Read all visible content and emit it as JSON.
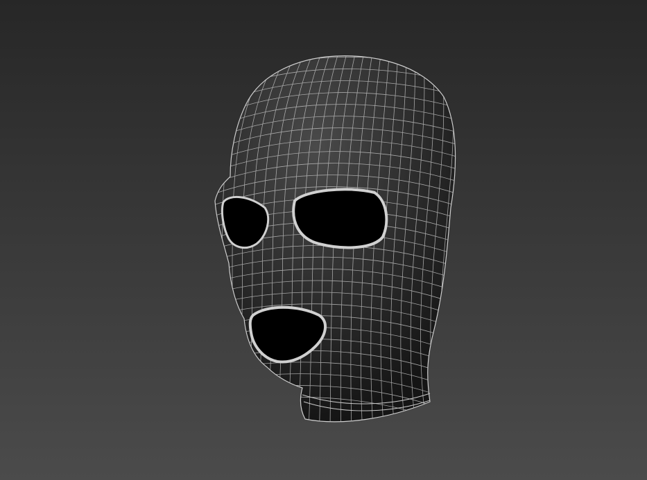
{
  "scene": {
    "subject": "wireframe-mask-model",
    "colors": {
      "background_top": "#272727",
      "background_bottom": "#4b4b4b",
      "mesh_fill_light": "#4a4a4a",
      "mesh_fill_dark": "#151515",
      "wire": "#bdbdbd",
      "hole": "#000000"
    }
  }
}
